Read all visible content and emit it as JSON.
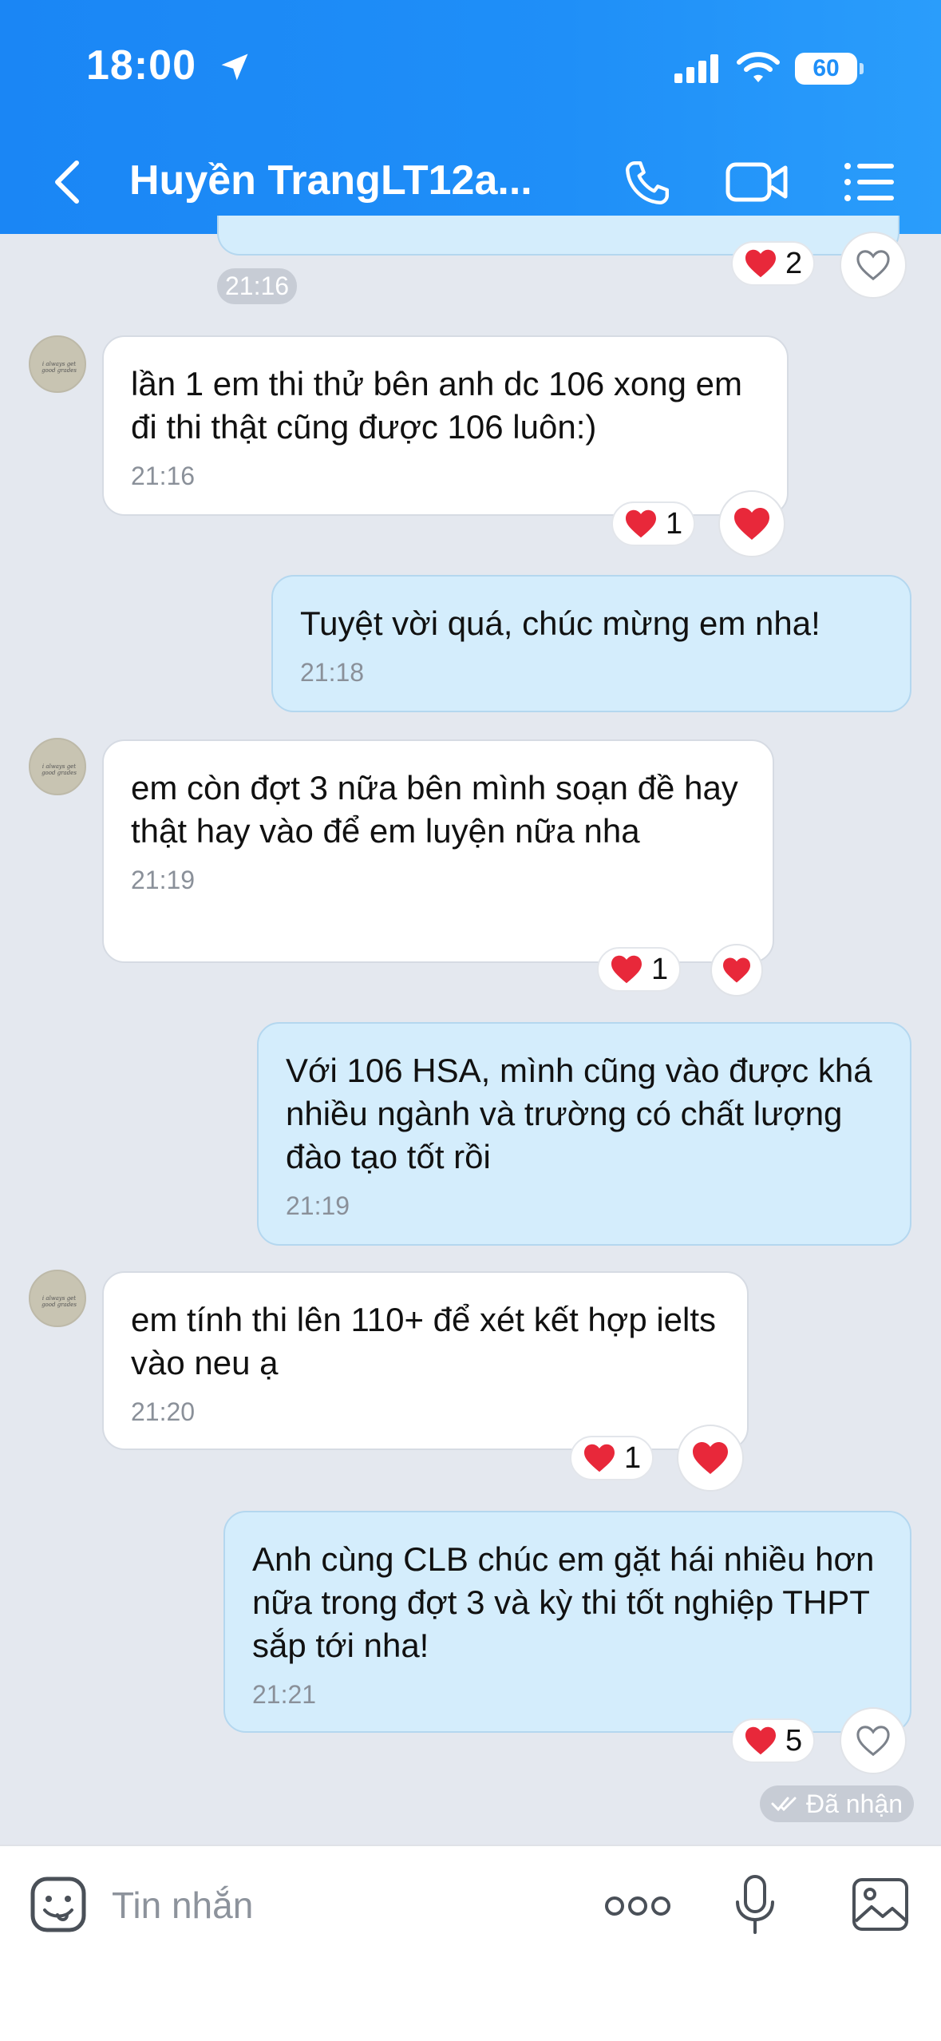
{
  "status": {
    "time": "18:00",
    "battery": "60"
  },
  "header": {
    "title": "Huyền TrangLT12a..."
  },
  "top_reaction": {
    "count": "2",
    "time": "21:16"
  },
  "messages": [
    {
      "side": "in",
      "text": "lần 1 em thi thử bên anh dc 106 xong em đi thi thật cũng được 106 luôn:)",
      "time": "21:16",
      "reaction_count": "1"
    },
    {
      "side": "out",
      "text": "Tuyệt vời quá, chúc mừng em nha!",
      "time": "21:18"
    },
    {
      "side": "in",
      "text": "em còn đợt 3 nữa bên mình soạn đề hay thật hay vào để em luyện nữa nha",
      "time": "21:19",
      "reaction_count": "1"
    },
    {
      "side": "out",
      "text": "Với 106 HSA, mình cũng vào được khá nhiều ngành và trường có chất lượng đào tạo tốt rồi",
      "time": "21:19"
    },
    {
      "side": "in",
      "text": "em tính thi lên 110+ để xét kết hợp ielts vào neu ạ",
      "time": "21:20",
      "reaction_count": "1"
    },
    {
      "side": "out",
      "text": "Anh cùng CLB chúc em gặt hái nhiều hơn nữa trong đợt 3 và kỳ thi tốt nghiệp THPT sắp tới nha!",
      "time": "21:21",
      "reaction_count": "5"
    }
  ],
  "received_label": "Đã nhận",
  "avatar_text": "i always get good grades",
  "input": {
    "placeholder": "Tin nhắn"
  },
  "colors": {
    "header": "#1f8ff8",
    "heart": "#e8283a",
    "out_bubble": "#d4edfc"
  }
}
